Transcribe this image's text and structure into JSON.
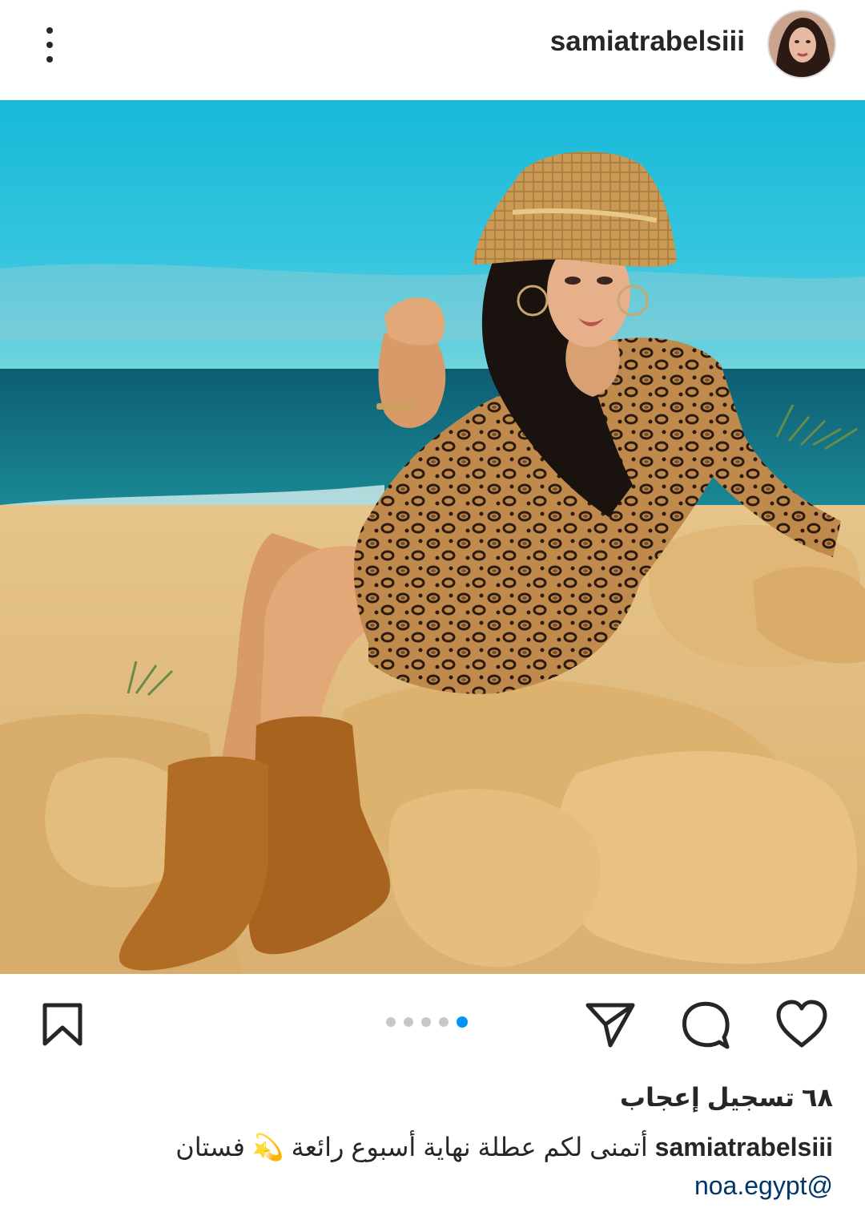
{
  "post": {
    "username": "samiatrabelsiii",
    "more_icon": "more-vertical-icon",
    "likes_text": "٦٨ تسجيل إعجاب",
    "caption_username": "samiatrabelsiii",
    "caption_text": "أتمنى لكم عطلة نهاية أسبوع رائعة 💫 فستان",
    "caption_tag": "@noa.egypt",
    "carousel": {
      "total": 5,
      "current_index": 5
    }
  },
  "actions": {
    "like_icon": "heart-icon",
    "comment_icon": "comment-icon",
    "share_icon": "send-icon",
    "save_icon": "bookmark-icon"
  },
  "colors": {
    "accent": "#0095f6",
    "text": "#262626",
    "link": "#00376b",
    "inactive_dot": "#c7c7c7"
  }
}
